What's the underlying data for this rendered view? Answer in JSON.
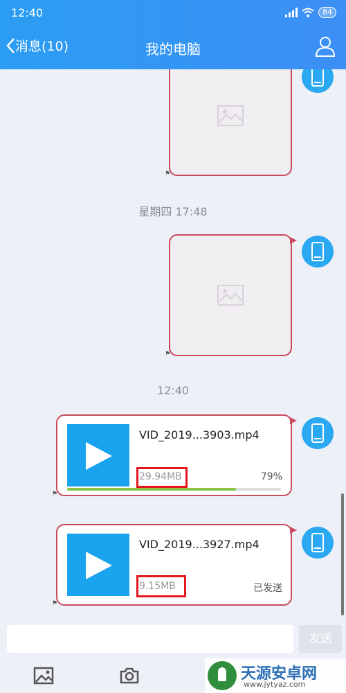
{
  "status_bar": {
    "time": "12:40",
    "battery": "84"
  },
  "header": {
    "back_label": "消息(10)",
    "title": "我的电脑"
  },
  "messages": {
    "timestamp_1": "星期四 17:48",
    "timestamp_2": "12:40",
    "video_1": {
      "file_name": "VID_2019...3903.mp4",
      "file_size": "29.94MB",
      "progress_text": "79%",
      "progress": 0.79
    },
    "video_2": {
      "file_name": "VID_2019...3927.mp4",
      "file_size": "9.15MB",
      "status": "已发送"
    }
  },
  "input": {
    "value": "",
    "send_label": "发送"
  },
  "toolbar": {
    "icons": [
      "image-icon",
      "camera-icon"
    ]
  },
  "watermark": {
    "title": "天源安卓网",
    "url": "www.jytyaz.com"
  },
  "colors": {
    "header": "#2b9df3",
    "avatar": "#2aa8f2",
    "video_thumb": "#1aa3ee",
    "bubble_border": "#c9495d",
    "highlight": "#e2161b",
    "progress": "#8bc34a"
  }
}
